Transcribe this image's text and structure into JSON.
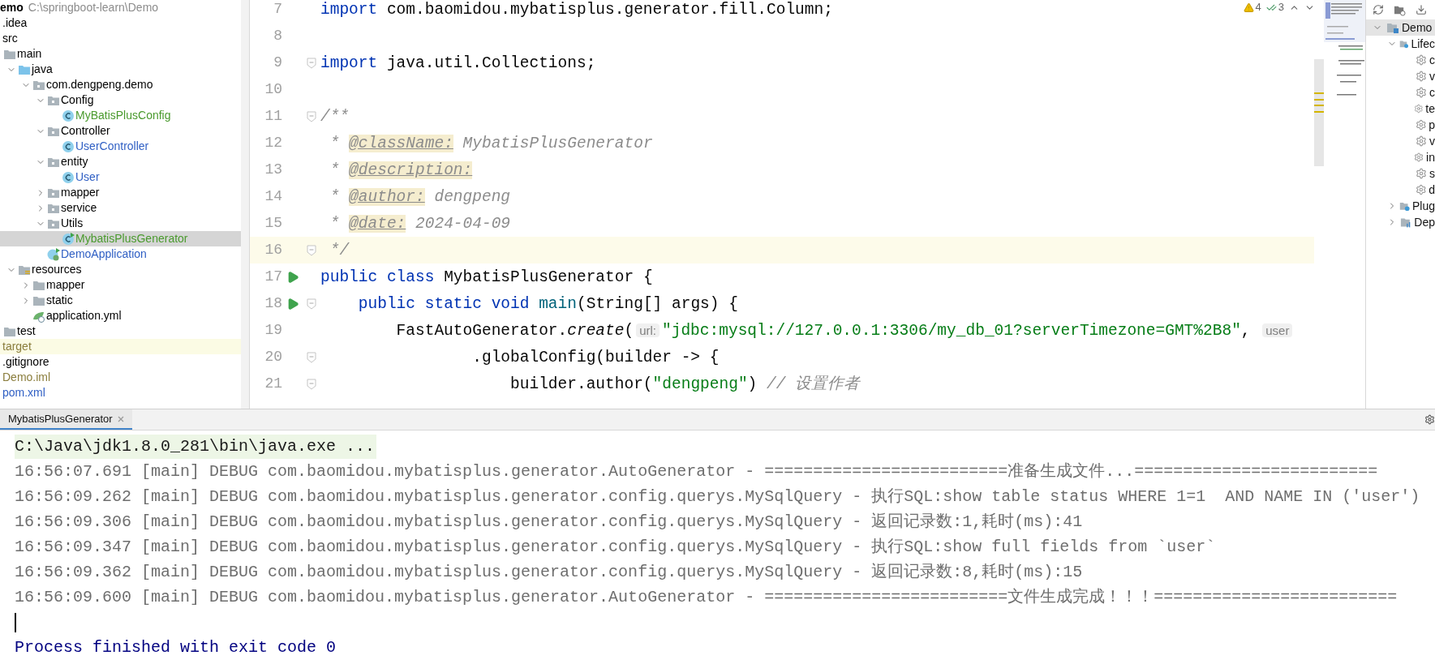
{
  "project_tree": {
    "root_name": "emo",
    "root_path": "C:\\springboot-learn\\Demo",
    "items": [
      {
        "label": ".idea",
        "color": "#000000",
        "selected": false
      },
      {
        "label": "src",
        "color": "#000000",
        "selected": false,
        "children": [
          {
            "label": "main",
            "kind": "folder",
            "color": "#000000",
            "selected": false,
            "children": [
              {
                "label": "java",
                "kind": "source-root",
                "expanded": true,
                "color": "#000000",
                "selected": false,
                "children": [
                  {
                    "label": "com.dengpeng.demo",
                    "kind": "package",
                    "expanded": true,
                    "color": "#000000",
                    "selected": false,
                    "children": [
                      {
                        "label": "Config",
                        "kind": "package",
                        "expanded": true,
                        "color": "#000000",
                        "selected": false,
                        "children": [
                          {
                            "label": "MyBatisPlusConfig",
                            "kind": "class",
                            "color": "#4a9a2e",
                            "selected": false
                          }
                        ]
                      },
                      {
                        "label": "Controller",
                        "kind": "package",
                        "expanded": true,
                        "color": "#000000",
                        "selected": false,
                        "children": [
                          {
                            "label": "UserController",
                            "kind": "class",
                            "color": "#2f5fc4",
                            "selected": false
                          }
                        ]
                      },
                      {
                        "label": "entity",
                        "kind": "package",
                        "expanded": true,
                        "color": "#000000",
                        "selected": false,
                        "children": [
                          {
                            "label": "User",
                            "kind": "class",
                            "color": "#2f5fc4",
                            "selected": false
                          }
                        ]
                      },
                      {
                        "label": "mapper",
                        "kind": "package",
                        "expanded": false,
                        "color": "#000000",
                        "selected": false
                      },
                      {
                        "label": "service",
                        "kind": "package",
                        "expanded": false,
                        "color": "#000000",
                        "selected": false
                      },
                      {
                        "label": "Utils",
                        "kind": "package",
                        "expanded": true,
                        "color": "#000000",
                        "selected": false,
                        "children": [
                          {
                            "label": "MybatisPlusGenerator",
                            "kind": "run-class",
                            "color": "#4a9a2e",
                            "selected": true
                          }
                        ]
                      },
                      {
                        "label": "DemoApplication",
                        "kind": "spring-app",
                        "color": "#2f5fc4",
                        "selected": false
                      }
                    ]
                  }
                ]
              },
              {
                "label": "resources",
                "kind": "resources-root",
                "expanded": true,
                "color": "#000000",
                "selected": false,
                "children": [
                  {
                    "label": "mapper",
                    "kind": "folder",
                    "expanded": false,
                    "color": "#000000",
                    "selected": false
                  },
                  {
                    "label": "static",
                    "kind": "folder",
                    "expanded": false,
                    "color": "#000000",
                    "selected": false
                  },
                  {
                    "label": "application.yml",
                    "kind": "yml",
                    "color": "#000000",
                    "selected": false
                  }
                ]
              }
            ]
          },
          {
            "label": "test",
            "kind": "folder",
            "color": "#000000",
            "selected": false
          }
        ]
      },
      {
        "label": "target",
        "color": "#8a7d3c",
        "selected": false,
        "ignored": true
      },
      {
        "label": ".gitignore",
        "color": "#000000",
        "selected": false
      },
      {
        "label": "Demo.iml",
        "color": "#8a7d3c",
        "selected": false
      },
      {
        "label": "pom.xml",
        "color": "#2f5fc4",
        "selected": false
      }
    ]
  },
  "editor": {
    "inspections": {
      "warnings": "4",
      "weak_warnings": "3"
    },
    "lines": [
      {
        "number": "7",
        "tokens": [
          {
            "kind": "keyword",
            "text": "import"
          },
          {
            "kind": "plain",
            "text": " com.baomidou.mybatisplus.generator.fill.Column;"
          }
        ]
      },
      {
        "number": "8"
      },
      {
        "number": "9",
        "fold": true,
        "tokens": [
          {
            "kind": "keyword",
            "text": "import"
          },
          {
            "kind": "plain",
            "text": " java.util.Collections;"
          }
        ]
      },
      {
        "number": "10"
      },
      {
        "number": "11",
        "fold": true,
        "tokens": [
          {
            "kind": "comment",
            "text": "/**"
          }
        ]
      },
      {
        "number": "12",
        "tokens": [
          {
            "kind": "comment",
            "text": " * "
          },
          {
            "kind": "doc-tag",
            "text": "@className:"
          },
          {
            "kind": "comment",
            "text": " MybatisPlusGenerator"
          }
        ]
      },
      {
        "number": "13",
        "tokens": [
          {
            "kind": "comment",
            "text": " * "
          },
          {
            "kind": "doc-tag",
            "text": "@description:"
          }
        ]
      },
      {
        "number": "14",
        "tokens": [
          {
            "kind": "comment",
            "text": " * "
          },
          {
            "kind": "doc-tag",
            "text": "@author:"
          },
          {
            "kind": "comment",
            "text": " dengpeng"
          }
        ]
      },
      {
        "number": "15",
        "tokens": [
          {
            "kind": "comment",
            "text": " * "
          },
          {
            "kind": "doc-tag",
            "text": "@date:"
          },
          {
            "kind": "comment",
            "text": " 2024-04-09"
          }
        ]
      },
      {
        "number": "16",
        "fold": true,
        "current": true,
        "tokens": [
          {
            "kind": "comment",
            "text": " */"
          }
        ]
      },
      {
        "number": "17",
        "run": true,
        "tokens": [
          {
            "kind": "keyword",
            "text": "public "
          },
          {
            "kind": "keyword",
            "text": "class "
          },
          {
            "kind": "plain",
            "text": "MybatisPlusGenerator {"
          }
        ]
      },
      {
        "number": "18",
        "run": true,
        "fold": true,
        "tokens": [
          {
            "kind": "keyword",
            "text": "    public "
          },
          {
            "kind": "keyword",
            "text": "static "
          },
          {
            "kind": "keyword",
            "text": "void "
          },
          {
            "kind": "method",
            "text": "main"
          },
          {
            "kind": "plain",
            "text": "(String[] args) {"
          }
        ]
      },
      {
        "number": "19",
        "tokens": [
          {
            "kind": "plain",
            "text": "        FastAutoGenerator."
          },
          {
            "kind": "italic",
            "text": "create"
          },
          {
            "kind": "plain",
            "text": "("
          },
          {
            "kind": "hint",
            "text": "url:"
          },
          {
            "kind": "string",
            "text": "\"jdbc:mysql://127.0.0.1:3306/my_db_01?serverTimezone=GMT%2B8\""
          },
          {
            "kind": "plain",
            "text": ", "
          },
          {
            "kind": "hint",
            "text": "user"
          }
        ]
      },
      {
        "number": "20",
        "fold": true,
        "tokens": [
          {
            "kind": "plain",
            "text": "                .globalConfig(builder -> {"
          }
        ]
      },
      {
        "number": "21",
        "fold": true,
        "tokens": [
          {
            "kind": "plain",
            "text": "                    builder.author("
          },
          {
            "kind": "string",
            "text": "\"dengpeng\""
          },
          {
            "kind": "plain",
            "text": ") "
          },
          {
            "kind": "comment",
            "text": "// 设置作者"
          }
        ]
      }
    ]
  },
  "maven_panel": {
    "items": [
      {
        "label": "Demo",
        "kind": "project",
        "expanded": true,
        "selected": true,
        "children": [
          {
            "label": "Lifec",
            "kind": "lifecycle",
            "expanded": true,
            "selected": false,
            "children": [
              {
                "label": "c",
                "kind": "goal",
                "selected": false
              },
              {
                "label": "v",
                "kind": "goal",
                "selected": false
              },
              {
                "label": "c",
                "kind": "goal",
                "selected": false
              },
              {
                "label": "te",
                "kind": "goal",
                "selected": false
              },
              {
                "label": "p",
                "kind": "goal",
                "selected": false
              },
              {
                "label": "v",
                "kind": "goal",
                "selected": false
              },
              {
                "label": "in",
                "kind": "goal",
                "selected": false
              },
              {
                "label": "s",
                "kind": "goal",
                "selected": false
              },
              {
                "label": "d",
                "kind": "goal",
                "selected": false
              }
            ]
          },
          {
            "label": "Plug",
            "kind": "plugins",
            "expanded": false,
            "selected": false
          },
          {
            "label": "Dep",
            "kind": "dependencies",
            "expanded": false,
            "selected": false
          }
        ]
      }
    ]
  },
  "run_panel": {
    "tab": {
      "label": "MybatisPlusGenerator",
      "selected": true
    },
    "lines": [
      {
        "kind": "command",
        "text": "C:\\Java\\jdk1.8.0_281\\bin\\java.exe ..."
      },
      {
        "kind": "log",
        "text": "16:56:07.691 [main] DEBUG com.baomidou.mybatisplus.generator.AutoGenerator - =========================准备生成文件...========================="
      },
      {
        "kind": "log",
        "text": "16:56:09.262 [main] DEBUG com.baomidou.mybatisplus.generator.config.querys.MySqlQuery - 执行SQL:show table status WHERE 1=1  AND NAME IN ('user')"
      },
      {
        "kind": "log",
        "text": "16:56:09.306 [main] DEBUG com.baomidou.mybatisplus.generator.config.querys.MySqlQuery - 返回记录数:1,耗时(ms):41"
      },
      {
        "kind": "log",
        "text": "16:56:09.347 [main] DEBUG com.baomidou.mybatisplus.generator.config.querys.MySqlQuery - 执行SQL:show full fields from `user`"
      },
      {
        "kind": "log",
        "text": "16:56:09.362 [main] DEBUG com.baomidou.mybatisplus.generator.config.querys.MySqlQuery - 返回记录数:8,耗时(ms):15"
      },
      {
        "kind": "log",
        "text": "16:56:09.600 [main] DEBUG com.baomidou.mybatisplus.generator.AutoGenerator - =========================文件生成完成！！！========================="
      },
      {
        "kind": "cursor"
      },
      {
        "kind": "exit",
        "text": "Process finished with exit code 0"
      }
    ]
  }
}
